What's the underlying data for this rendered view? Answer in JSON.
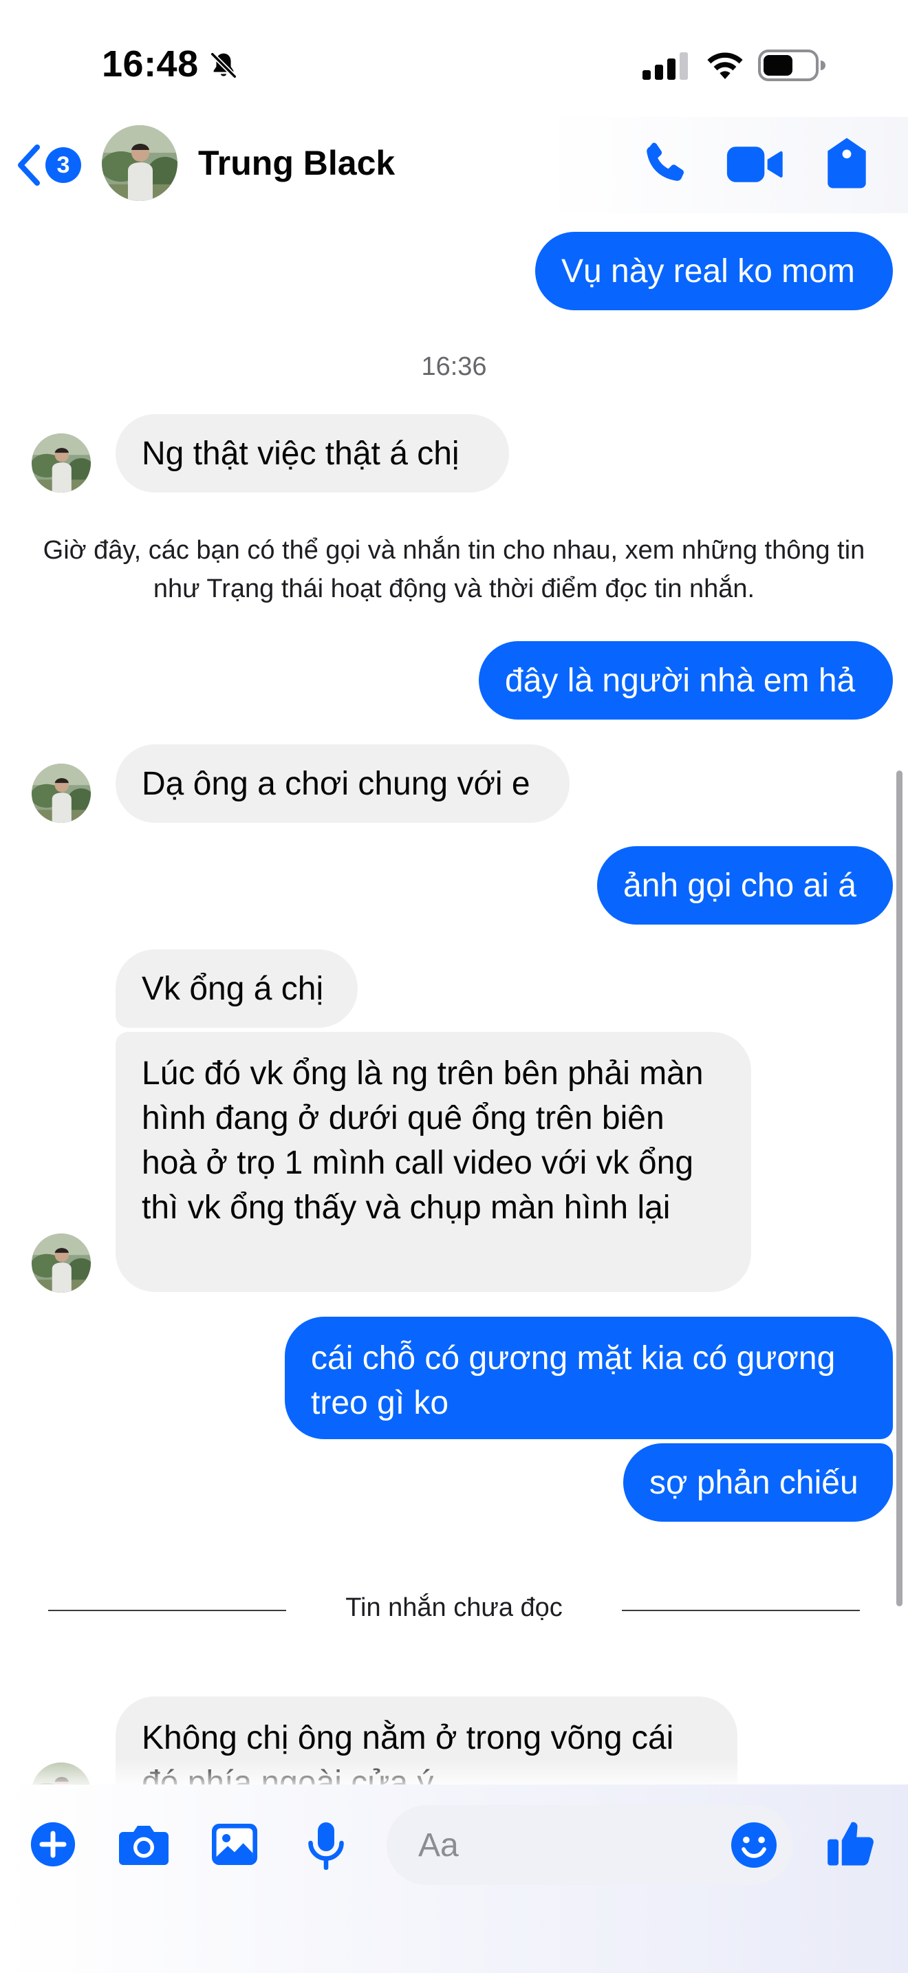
{
  "status_bar": {
    "time": "16:48"
  },
  "header": {
    "back_badge": "3",
    "contact_name": "Trung Black"
  },
  "chat": {
    "msg_1": "Vụ này real ko mom",
    "timestamp": "16:36",
    "msg_2": "Ng thật việc thật á chị",
    "system_note": "Giờ đây, các bạn có thể gọi và nhắn tin cho nhau, xem những thông tin như Trạng thái hoạt động và thời điểm đọc tin nhắn.",
    "msg_3": "đây là người nhà em hả",
    "msg_4": "Dạ ông a chơi chung với e",
    "msg_5": "ảnh gọi cho ai á",
    "msg_6": "Vk ổng á chị",
    "msg_7": "Lúc đó vk ổng là ng trên bên phải màn hình đang ở dưới quê ổng trên biên hoà ở trọ 1 mình call video với vk ổng thì vk ổng thấy và chụp màn hình lại",
    "msg_8": "cái chỗ có gương mặt kia có gương treo gì ko",
    "msg_9": "sợ phản chiếu",
    "unread_label": "Tin nhắn chưa đọc",
    "msg_10": "Không chị ông nằm ở trong võng cái đó phía ngoài cửa ý"
  },
  "composer": {
    "placeholder": "Aa"
  },
  "colors": {
    "accent": "#0866ff",
    "incoming_bubble": "#f0f0f0"
  }
}
